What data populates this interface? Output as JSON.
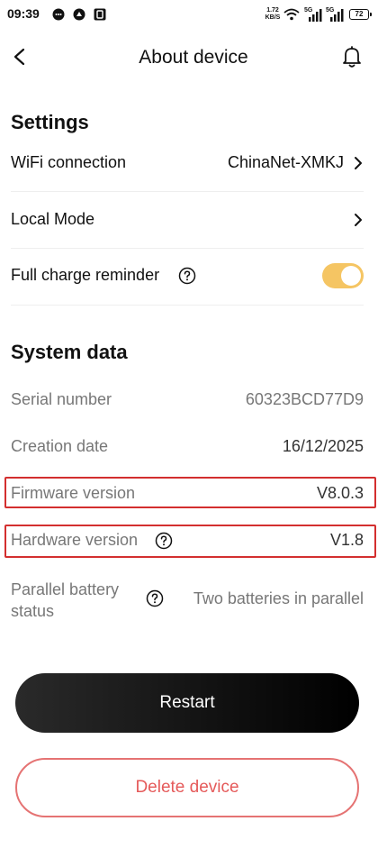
{
  "status_bar": {
    "time": "09:39",
    "network_speed_value": "1.72",
    "network_speed_unit": "KB/S",
    "signal1": "5G",
    "signal2": "5G",
    "battery": "72"
  },
  "header": {
    "title": "About device",
    "back_icon": "chevron-left-icon",
    "bell_icon": "bell-icon"
  },
  "settings": {
    "title": "Settings",
    "wifi": {
      "label": "WiFi connection",
      "value": "ChinaNet-XMKJ"
    },
    "local_mode": {
      "label": "Local Mode"
    },
    "full_charge": {
      "label": "Full charge reminder",
      "enabled": true
    }
  },
  "system_data": {
    "title": "System data",
    "serial": {
      "label": "Serial number",
      "value": "60323BCD77D9"
    },
    "creation": {
      "label": "Creation date",
      "value": "16/12/2025"
    },
    "firmware": {
      "label": "Firmware version",
      "value": "V8.0.3"
    },
    "hardware": {
      "label": "Hardware version",
      "value": "V1.8"
    },
    "parallel": {
      "label_line1": "Parallel battery",
      "label_line2": "status",
      "value": "Two batteries in parallel"
    }
  },
  "actions": {
    "restart": "Restart",
    "delete": "Delete device"
  },
  "colors": {
    "toggle_on": "#f5c563",
    "highlight": "#d32f2f",
    "delete_accent": "#e55a5a"
  }
}
